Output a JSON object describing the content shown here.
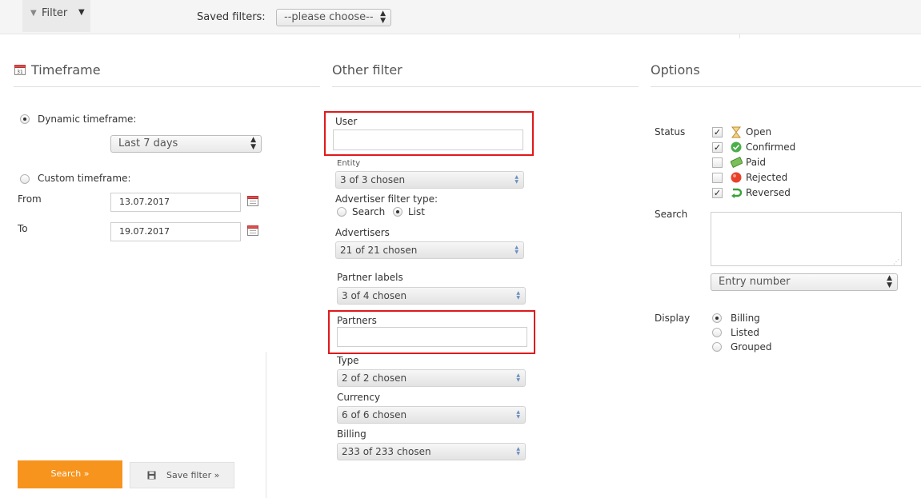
{
  "topbar": {
    "filter_label": "Filter",
    "saved_filters_label": "Saved filters:",
    "saved_filters_value": "--please choose--"
  },
  "timeframe": {
    "title": "Timeframe",
    "dynamic_label": "Dynamic timeframe:",
    "dynamic_value": "Last 7 days",
    "custom_label": "Custom timeframe:",
    "from_label": "From",
    "from_value": "13.07.2017",
    "to_label": "To",
    "to_value": "19.07.2017"
  },
  "other_filter": {
    "title": "Other filter",
    "user_label": "User",
    "user_value": "",
    "entity_label": "Entity",
    "entity_value": "3 of 3 chosen",
    "adv_filter_type_label": "Advertiser filter type:",
    "adv_filter_search": "Search",
    "adv_filter_list": "List",
    "advertisers_label": "Advertisers",
    "advertisers_value": "21 of 21 chosen",
    "partner_labels_label": "Partner labels",
    "partner_labels_value": "3 of 4 chosen",
    "partners_label": "Partners",
    "partners_value": "",
    "type_label": "Type",
    "type_value": "2 of 2 chosen",
    "currency_label": "Currency",
    "currency_value": "6 of 6 chosen",
    "billing_label": "Billing",
    "billing_value": "233 of 233 chosen"
  },
  "options": {
    "title": "Options",
    "status_label": "Status",
    "statuses": [
      {
        "label": "Open",
        "checked": true
      },
      {
        "label": "Confirmed",
        "checked": true
      },
      {
        "label": "Paid",
        "checked": false
      },
      {
        "label": "Rejected",
        "checked": false
      },
      {
        "label": "Reversed",
        "checked": true
      }
    ],
    "search_label": "Search",
    "search_value": "",
    "search_field_select": "Entry number",
    "display_label": "Display",
    "display_options": [
      "Billing",
      "Listed",
      "Grouped"
    ],
    "display_selected": "Billing"
  },
  "buttons": {
    "search": "Search »",
    "save_filter": "Save filter »"
  },
  "colors": {
    "accent": "#f7941e",
    "highlight_box": "#e0191b"
  }
}
